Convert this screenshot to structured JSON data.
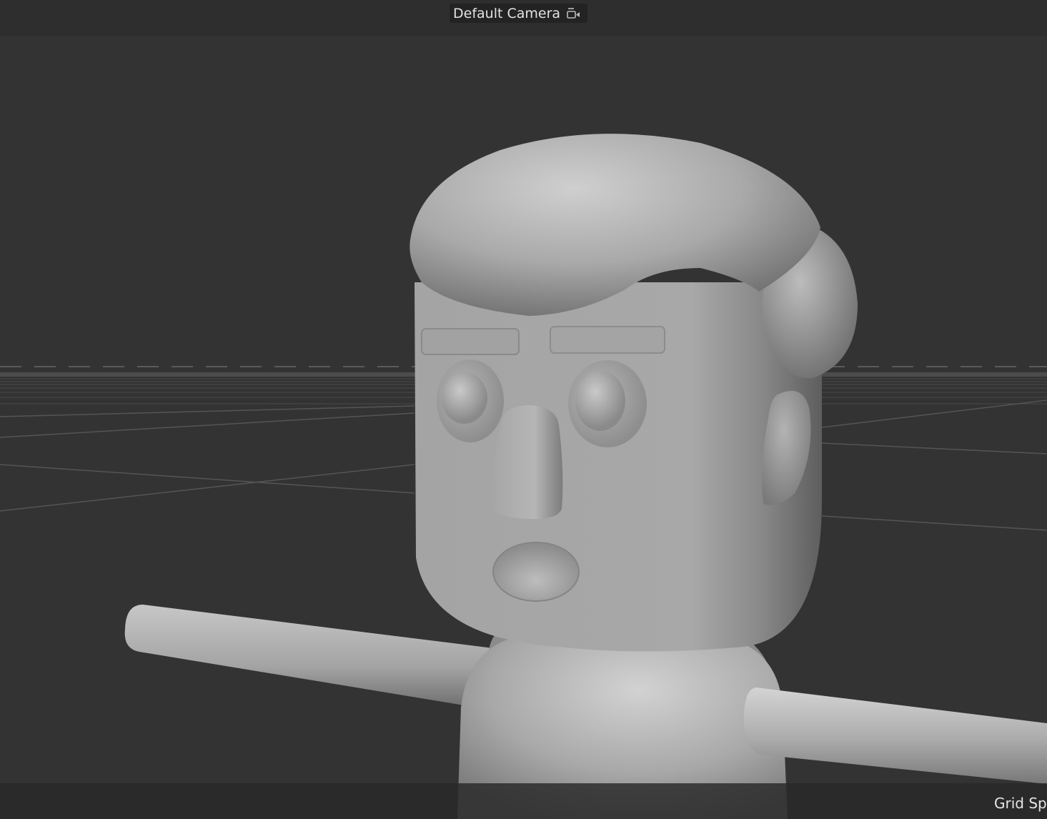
{
  "top_bar": {
    "camera_label": "Default Camera",
    "camera_icon": "camera-view-icon"
  },
  "bottom_bar": {
    "grid_label": "Grid Sp"
  },
  "colors": {
    "viewport_bg": "#333333",
    "bar_bg": "#2e2e2e",
    "model_gray": "#a8a8a8"
  }
}
